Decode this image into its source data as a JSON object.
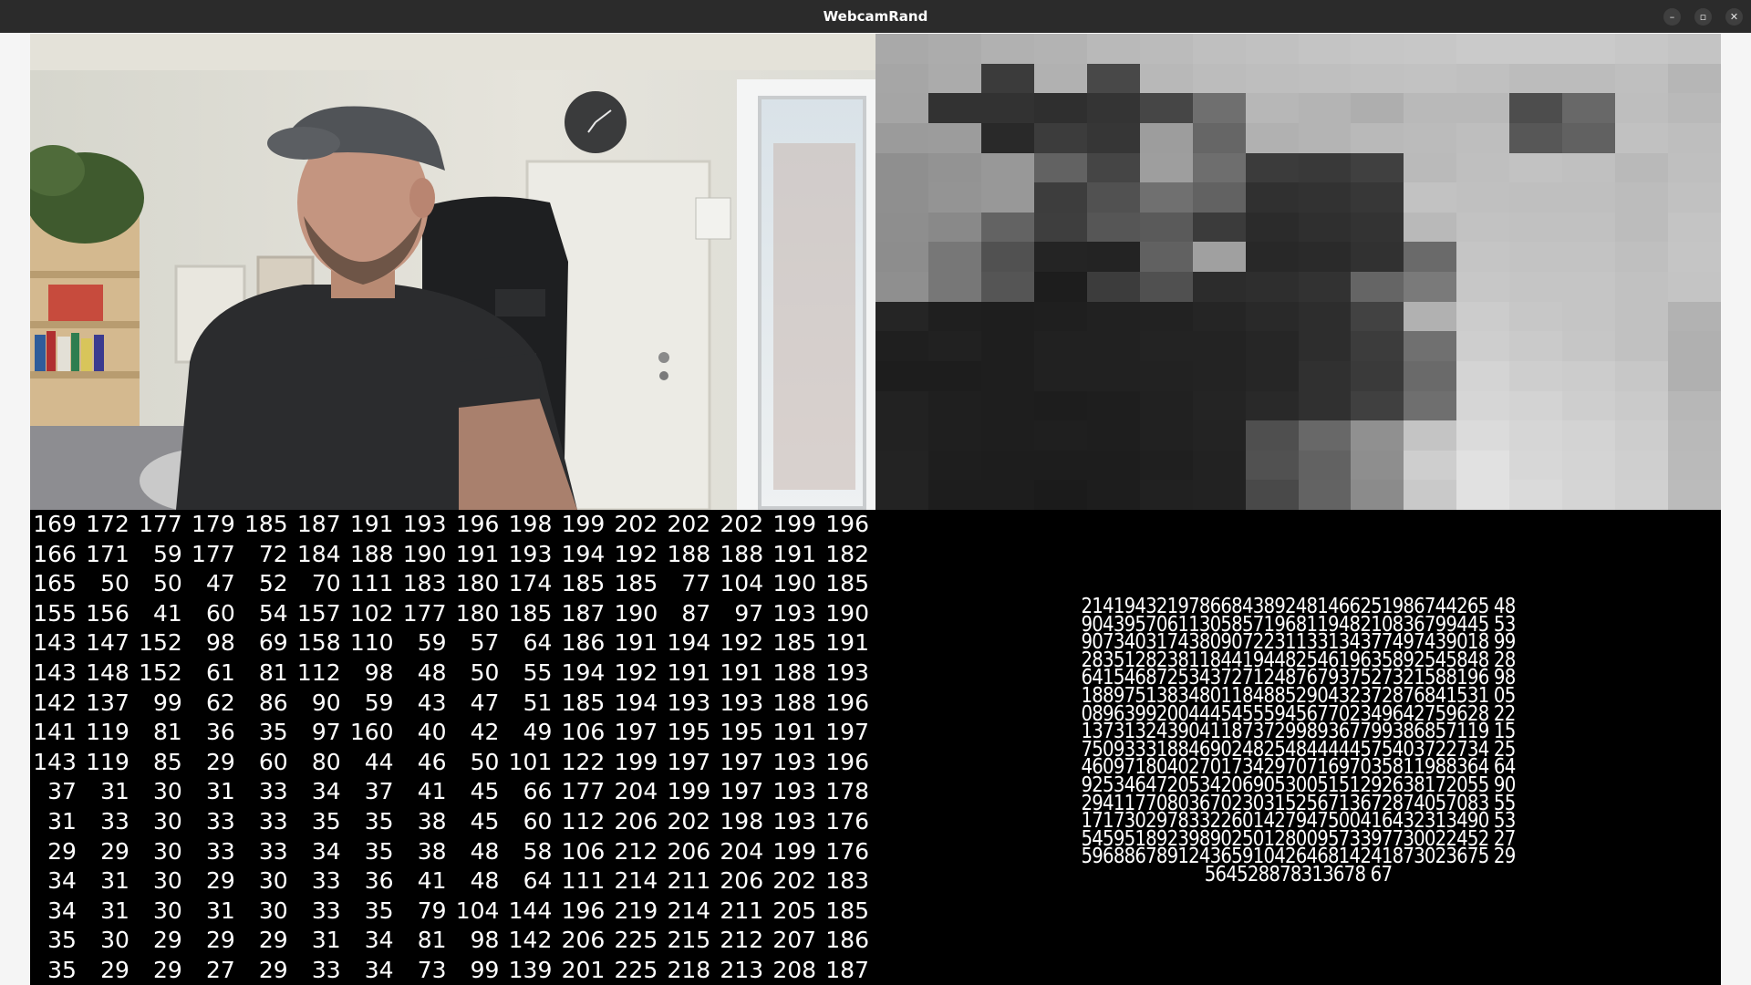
{
  "window": {
    "title": "WebcamRand",
    "buttons": {
      "minimize": "–",
      "maximize": "▫",
      "close": "✕"
    }
  },
  "pixelated_preview": {
    "cols": 16,
    "rows": 8,
    "values": [
      [
        169,
        172,
        177,
        179,
        185,
        187,
        191,
        193,
        196,
        198,
        199,
        202,
        202,
        202,
        199,
        196
      ],
      [
        166,
        171,
        59,
        177,
        72,
        184,
        188,
        190,
        191,
        193,
        194,
        192,
        188,
        188,
        191,
        182
      ],
      [
        165,
        50,
        50,
        47,
        52,
        70,
        111,
        183,
        180,
        174,
        185,
        185,
        77,
        104,
        190,
        185
      ],
      [
        155,
        156,
        41,
        60,
        54,
        157,
        102,
        177,
        180,
        185,
        187,
        190,
        87,
        97,
        193,
        190
      ],
      [
        143,
        147,
        152,
        98,
        69,
        158,
        110,
        59,
        57,
        64,
        186,
        191,
        194,
        192,
        185,
        191
      ],
      [
        143,
        148,
        152,
        61,
        81,
        112,
        98,
        48,
        50,
        55,
        194,
        192,
        191,
        191,
        188,
        193
      ],
      [
        142,
        137,
        99,
        62,
        86,
        90,
        59,
        43,
        47,
        51,
        185,
        194,
        193,
        193,
        188,
        196
      ],
      [
        141,
        119,
        81,
        36,
        35,
        97,
        160,
        40,
        42,
        49,
        106,
        197,
        195,
        195,
        191,
        197
      ],
      [
        143,
        119,
        85,
        29,
        60,
        80,
        44,
        46,
        50,
        101,
        122,
        199,
        197,
        197,
        193,
        196
      ],
      [
        37,
        31,
        30,
        31,
        33,
        34,
        37,
        41,
        45,
        66,
        177,
        204,
        199,
        197,
        193,
        178
      ],
      [
        31,
        33,
        30,
        33,
        33,
        35,
        35,
        38,
        45,
        60,
        112,
        206,
        202,
        198,
        193,
        176
      ],
      [
        29,
        29,
        30,
        33,
        33,
        34,
        35,
        38,
        48,
        58,
        106,
        212,
        206,
        204,
        199,
        176
      ],
      [
        34,
        31,
        30,
        29,
        30,
        33,
        36,
        41,
        48,
        64,
        111,
        214,
        211,
        206,
        202,
        183
      ],
      [
        34,
        31,
        30,
        31,
        30,
        33,
        35,
        79,
        104,
        144,
        196,
        219,
        214,
        211,
        205,
        185
      ],
      [
        35,
        30,
        29,
        29,
        29,
        31,
        34,
        81,
        98,
        142,
        206,
        225,
        215,
        212,
        207,
        186
      ],
      [
        35,
        29,
        29,
        27,
        29,
        33,
        34,
        73,
        99,
        139,
        201,
        225,
        218,
        213,
        208,
        187
      ]
    ]
  },
  "number_grid": {
    "rows": [
      [
        "169",
        "172",
        "177",
        "179",
        "185",
        "187",
        "191",
        "193",
        "196",
        "198",
        "199",
        "202",
        "202",
        "202",
        "199",
        "196"
      ],
      [
        "166",
        "171",
        "59",
        "177",
        "72",
        "184",
        "188",
        "190",
        "191",
        "193",
        "194",
        "192",
        "188",
        "188",
        "191",
        "182"
      ],
      [
        "165",
        "50",
        "50",
        "47",
        "52",
        "70",
        "111",
        "183",
        "180",
        "174",
        "185",
        "185",
        "77",
        "104",
        "190",
        "185"
      ],
      [
        "155",
        "156",
        "41",
        "60",
        "54",
        "157",
        "102",
        "177",
        "180",
        "185",
        "187",
        "190",
        "87",
        "97",
        "193",
        "190"
      ],
      [
        "143",
        "147",
        "152",
        "98",
        "69",
        "158",
        "110",
        "59",
        "57",
        "64",
        "186",
        "191",
        "194",
        "192",
        "185",
        "191"
      ],
      [
        "143",
        "148",
        "152",
        "61",
        "81",
        "112",
        "98",
        "48",
        "50",
        "55",
        "194",
        "192",
        "191",
        "191",
        "188",
        "193"
      ],
      [
        "142",
        "137",
        "99",
        "62",
        "86",
        "90",
        "59",
        "43",
        "47",
        "51",
        "185",
        "194",
        "193",
        "193",
        "188",
        "196"
      ],
      [
        "141",
        "119",
        "81",
        "36",
        "35",
        "97",
        "160",
        "40",
        "42",
        "49",
        "106",
        "197",
        "195",
        "195",
        "191",
        "197"
      ],
      [
        "143",
        "119",
        "85",
        "29",
        "60",
        "80",
        "44",
        "46",
        "50",
        "101",
        "122",
        "199",
        "197",
        "197",
        "193",
        "196"
      ],
      [
        "37",
        "31",
        "30",
        "31",
        "33",
        "34",
        "37",
        "41",
        "45",
        "66",
        "177",
        "204",
        "199",
        "197",
        "193",
        "178"
      ],
      [
        "31",
        "33",
        "30",
        "33",
        "33",
        "35",
        "35",
        "38",
        "45",
        "60",
        "112",
        "206",
        "202",
        "198",
        "193",
        "176"
      ],
      [
        "29",
        "29",
        "30",
        "33",
        "33",
        "34",
        "35",
        "38",
        "48",
        "58",
        "106",
        "212",
        "206",
        "204",
        "199",
        "176"
      ],
      [
        "34",
        "31",
        "30",
        "29",
        "30",
        "33",
        "36",
        "41",
        "48",
        "64",
        "111",
        "214",
        "211",
        "206",
        "202",
        "183"
      ],
      [
        "34",
        "31",
        "30",
        "31",
        "30",
        "33",
        "35",
        "79",
        "104",
        "144",
        "196",
        "219",
        "214",
        "211",
        "205",
        "185"
      ],
      [
        "35",
        "30",
        "29",
        "29",
        "29",
        "31",
        "34",
        "81",
        "98",
        "142",
        "206",
        "225",
        "215",
        "212",
        "207",
        "186"
      ],
      [
        "35",
        "29",
        "29",
        "27",
        "29",
        "33",
        "34",
        "73",
        "99",
        "139",
        "201",
        "225",
        "218",
        "213",
        "208",
        "187"
      ]
    ]
  },
  "random_output": {
    "lines": [
      "21419432197866843892481466251986744265 48",
      "90439570611305857196811948210836799445 53",
      "90734031743809072231133134377497439018 99",
      "28351282381184419448254619635892545848 28",
      "64154687253437271248767937527321588196 98",
      "18897513834801184885290432372876841531 05",
      "08963992004445455594567702349642759628 22",
      "13731324390411873729989367799386857119 15",
      "75093331884690248254844444575403722734 25",
      "46097180402701734297071697035811988364 64",
      "92534647205342069053005151292638172055 90",
      "29411770803670230315256713672874057083 55",
      "17173029783322601427947500416432313490 53",
      "54595189239890250128009573397730022452 27",
      "59688678912436591042646814241873023675 29",
      "564528878313678 67"
    ]
  }
}
